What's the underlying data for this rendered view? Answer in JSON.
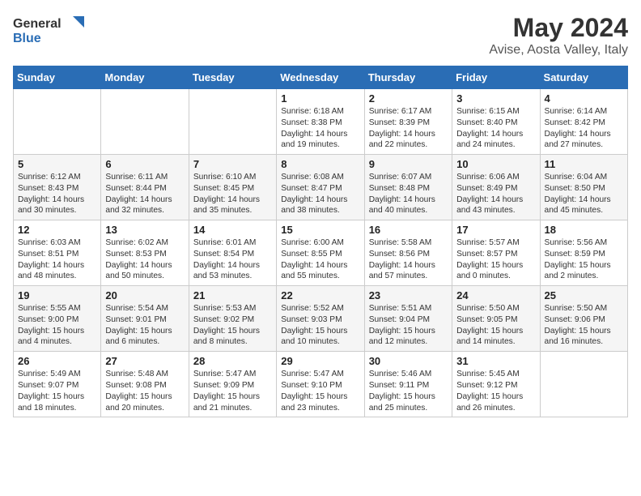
{
  "header": {
    "logo_general": "General",
    "logo_blue": "Blue",
    "main_title": "May 2024",
    "subtitle": "Avise, Aosta Valley, Italy"
  },
  "days_of_week": [
    "Sunday",
    "Monday",
    "Tuesday",
    "Wednesday",
    "Thursday",
    "Friday",
    "Saturday"
  ],
  "weeks": [
    [
      {
        "day": "",
        "info": ""
      },
      {
        "day": "",
        "info": ""
      },
      {
        "day": "",
        "info": ""
      },
      {
        "day": "1",
        "info": "Sunrise: 6:18 AM\nSunset: 8:38 PM\nDaylight: 14 hours\nand 19 minutes."
      },
      {
        "day": "2",
        "info": "Sunrise: 6:17 AM\nSunset: 8:39 PM\nDaylight: 14 hours\nand 22 minutes."
      },
      {
        "day": "3",
        "info": "Sunrise: 6:15 AM\nSunset: 8:40 PM\nDaylight: 14 hours\nand 24 minutes."
      },
      {
        "day": "4",
        "info": "Sunrise: 6:14 AM\nSunset: 8:42 PM\nDaylight: 14 hours\nand 27 minutes."
      }
    ],
    [
      {
        "day": "5",
        "info": "Sunrise: 6:12 AM\nSunset: 8:43 PM\nDaylight: 14 hours\nand 30 minutes."
      },
      {
        "day": "6",
        "info": "Sunrise: 6:11 AM\nSunset: 8:44 PM\nDaylight: 14 hours\nand 32 minutes."
      },
      {
        "day": "7",
        "info": "Sunrise: 6:10 AM\nSunset: 8:45 PM\nDaylight: 14 hours\nand 35 minutes."
      },
      {
        "day": "8",
        "info": "Sunrise: 6:08 AM\nSunset: 8:47 PM\nDaylight: 14 hours\nand 38 minutes."
      },
      {
        "day": "9",
        "info": "Sunrise: 6:07 AM\nSunset: 8:48 PM\nDaylight: 14 hours\nand 40 minutes."
      },
      {
        "day": "10",
        "info": "Sunrise: 6:06 AM\nSunset: 8:49 PM\nDaylight: 14 hours\nand 43 minutes."
      },
      {
        "day": "11",
        "info": "Sunrise: 6:04 AM\nSunset: 8:50 PM\nDaylight: 14 hours\nand 45 minutes."
      }
    ],
    [
      {
        "day": "12",
        "info": "Sunrise: 6:03 AM\nSunset: 8:51 PM\nDaylight: 14 hours\nand 48 minutes."
      },
      {
        "day": "13",
        "info": "Sunrise: 6:02 AM\nSunset: 8:53 PM\nDaylight: 14 hours\nand 50 minutes."
      },
      {
        "day": "14",
        "info": "Sunrise: 6:01 AM\nSunset: 8:54 PM\nDaylight: 14 hours\nand 53 minutes."
      },
      {
        "day": "15",
        "info": "Sunrise: 6:00 AM\nSunset: 8:55 PM\nDaylight: 14 hours\nand 55 minutes."
      },
      {
        "day": "16",
        "info": "Sunrise: 5:58 AM\nSunset: 8:56 PM\nDaylight: 14 hours\nand 57 minutes."
      },
      {
        "day": "17",
        "info": "Sunrise: 5:57 AM\nSunset: 8:57 PM\nDaylight: 15 hours\nand 0 minutes."
      },
      {
        "day": "18",
        "info": "Sunrise: 5:56 AM\nSunset: 8:59 PM\nDaylight: 15 hours\nand 2 minutes."
      }
    ],
    [
      {
        "day": "19",
        "info": "Sunrise: 5:55 AM\nSunset: 9:00 PM\nDaylight: 15 hours\nand 4 minutes."
      },
      {
        "day": "20",
        "info": "Sunrise: 5:54 AM\nSunset: 9:01 PM\nDaylight: 15 hours\nand 6 minutes."
      },
      {
        "day": "21",
        "info": "Sunrise: 5:53 AM\nSunset: 9:02 PM\nDaylight: 15 hours\nand 8 minutes."
      },
      {
        "day": "22",
        "info": "Sunrise: 5:52 AM\nSunset: 9:03 PM\nDaylight: 15 hours\nand 10 minutes."
      },
      {
        "day": "23",
        "info": "Sunrise: 5:51 AM\nSunset: 9:04 PM\nDaylight: 15 hours\nand 12 minutes."
      },
      {
        "day": "24",
        "info": "Sunrise: 5:50 AM\nSunset: 9:05 PM\nDaylight: 15 hours\nand 14 minutes."
      },
      {
        "day": "25",
        "info": "Sunrise: 5:50 AM\nSunset: 9:06 PM\nDaylight: 15 hours\nand 16 minutes."
      }
    ],
    [
      {
        "day": "26",
        "info": "Sunrise: 5:49 AM\nSunset: 9:07 PM\nDaylight: 15 hours\nand 18 minutes."
      },
      {
        "day": "27",
        "info": "Sunrise: 5:48 AM\nSunset: 9:08 PM\nDaylight: 15 hours\nand 20 minutes."
      },
      {
        "day": "28",
        "info": "Sunrise: 5:47 AM\nSunset: 9:09 PM\nDaylight: 15 hours\nand 21 minutes."
      },
      {
        "day": "29",
        "info": "Sunrise: 5:47 AM\nSunset: 9:10 PM\nDaylight: 15 hours\nand 23 minutes."
      },
      {
        "day": "30",
        "info": "Sunrise: 5:46 AM\nSunset: 9:11 PM\nDaylight: 15 hours\nand 25 minutes."
      },
      {
        "day": "31",
        "info": "Sunrise: 5:45 AM\nSunset: 9:12 PM\nDaylight: 15 hours\nand 26 minutes."
      },
      {
        "day": "",
        "info": ""
      }
    ]
  ]
}
